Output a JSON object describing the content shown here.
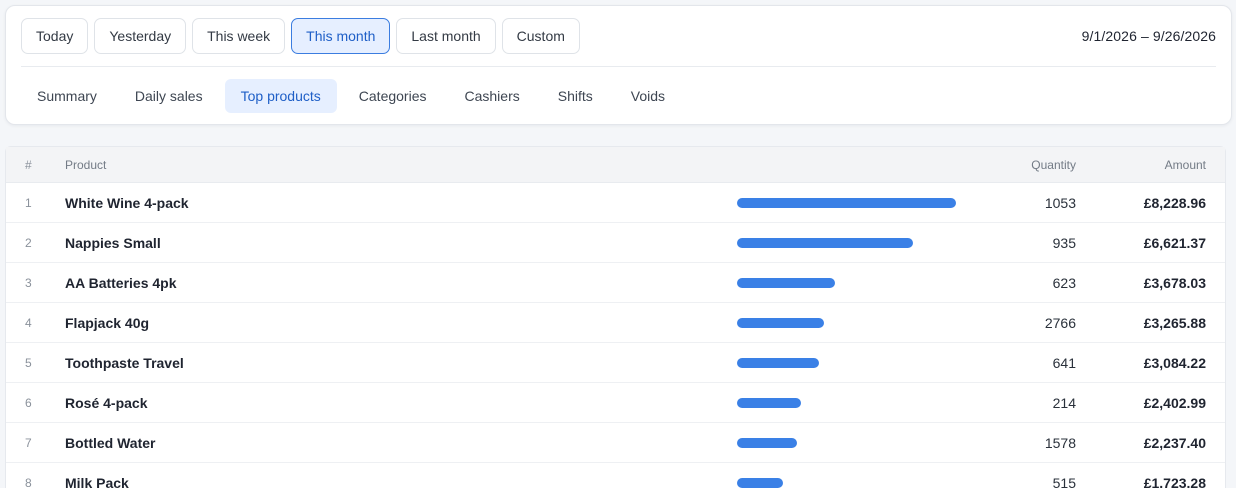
{
  "range_buttons": [
    "Today",
    "Yesterday",
    "This week",
    "This month",
    "Last month",
    "Custom"
  ],
  "active_range": "This month",
  "date_range": "9/1/2026 – 9/26/2026",
  "tabs": [
    "Summary",
    "Daily sales",
    "Top products",
    "Categories",
    "Cashiers",
    "Shifts",
    "Voids"
  ],
  "active_tab": "Top products",
  "colors": {
    "accent": "#3a80e6",
    "active_bg": "#e6efff",
    "active_text": "#1f5fc7"
  },
  "table": {
    "headers": {
      "num": "#",
      "product": "Product",
      "quantity": "Quantity",
      "amount": "Amount"
    },
    "rows": [
      {
        "num": "1",
        "product": "White Wine 4-pack",
        "quantity": "1053",
        "amount": "£8,228.96",
        "share": 1.0
      },
      {
        "num": "2",
        "product": "Nappies Small",
        "quantity": "935",
        "amount": "£6,621.37",
        "share": 0.805
      },
      {
        "num": "3",
        "product": "AA Batteries 4pk",
        "quantity": "623",
        "amount": "£3,678.03",
        "share": 0.447
      },
      {
        "num": "4",
        "product": "Flapjack 40g",
        "quantity": "2766",
        "amount": "£3,265.88",
        "share": 0.397
      },
      {
        "num": "5",
        "product": "Toothpaste Travel",
        "quantity": "641",
        "amount": "£3,084.22",
        "share": 0.375
      },
      {
        "num": "6",
        "product": "Rosé 4-pack",
        "quantity": "214",
        "amount": "£2,402.99",
        "share": 0.292
      },
      {
        "num": "7",
        "product": "Bottled Water",
        "quantity": "1578",
        "amount": "£2,237.40",
        "share": 0.272
      },
      {
        "num": "8",
        "product": "Milk Pack",
        "quantity": "515",
        "amount": "£1,723.28",
        "share": 0.209
      }
    ]
  }
}
